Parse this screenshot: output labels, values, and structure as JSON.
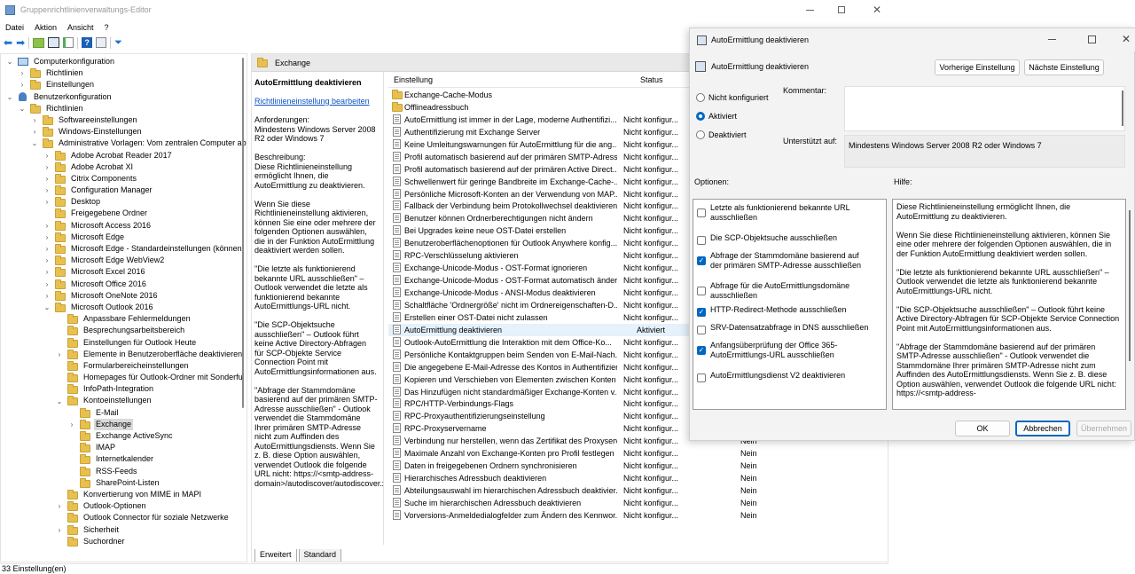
{
  "window": {
    "title": "Gruppenrichtlinienverwaltungs-Editor"
  },
  "menu": [
    "Datei",
    "Aktion",
    "Ansicht",
    "?"
  ],
  "tree": [
    {
      "label": "Computerkonfiguration",
      "lvl": 0,
      "exp": "v",
      "ic": "pc"
    },
    {
      "label": "Richtlinien",
      "lvl": 1,
      "exp": ">",
      "ic": "f"
    },
    {
      "label": "Einstellungen",
      "lvl": 1,
      "exp": ">",
      "ic": "f"
    },
    {
      "label": "Benutzerkonfiguration",
      "lvl": 0,
      "exp": "v",
      "ic": "user"
    },
    {
      "label": "Richtlinien",
      "lvl": 1,
      "exp": "v",
      "ic": "f"
    },
    {
      "label": "Softwareeinstellungen",
      "lvl": 2,
      "exp": ">",
      "ic": "f"
    },
    {
      "label": "Windows-Einstellungen",
      "lvl": 2,
      "exp": ">",
      "ic": "f"
    },
    {
      "label": "Administrative Vorlagen: Vom zentralen Computer ab",
      "lvl": 2,
      "exp": "v",
      "ic": "f"
    },
    {
      "label": "Adobe Acrobat Reader 2017",
      "lvl": 3,
      "exp": ">",
      "ic": "f"
    },
    {
      "label": "Adobe Acrobat XI",
      "lvl": 3,
      "exp": ">",
      "ic": "f"
    },
    {
      "label": "Citrix Components",
      "lvl": 3,
      "exp": ">",
      "ic": "f"
    },
    {
      "label": "Configuration Manager",
      "lvl": 3,
      "exp": ">",
      "ic": "f"
    },
    {
      "label": "Desktop",
      "lvl": 3,
      "exp": ">",
      "ic": "f"
    },
    {
      "label": "Freigegebene Ordner",
      "lvl": 3,
      "exp": "",
      "ic": "f"
    },
    {
      "label": "Microsoft Access 2016",
      "lvl": 3,
      "exp": ">",
      "ic": "f"
    },
    {
      "label": "Microsoft Edge",
      "lvl": 3,
      "exp": ">",
      "ic": "f"
    },
    {
      "label": "Microsoft Edge - Standardeinstellungen (können",
      "lvl": 3,
      "exp": ">",
      "ic": "f"
    },
    {
      "label": "Microsoft Edge WebView2",
      "lvl": 3,
      "exp": ">",
      "ic": "f"
    },
    {
      "label": "Microsoft Excel 2016",
      "lvl": 3,
      "exp": ">",
      "ic": "f"
    },
    {
      "label": "Microsoft Office 2016",
      "lvl": 3,
      "exp": ">",
      "ic": "f"
    },
    {
      "label": "Microsoft OneNote 2016",
      "lvl": 3,
      "exp": ">",
      "ic": "f"
    },
    {
      "label": "Microsoft Outlook 2016",
      "lvl": 3,
      "exp": "v",
      "ic": "f"
    },
    {
      "label": "Anpassbare Fehlermeldungen",
      "lvl": 4,
      "exp": "",
      "ic": "f"
    },
    {
      "label": "Besprechungsarbeitsbereich",
      "lvl": 4,
      "exp": "",
      "ic": "f"
    },
    {
      "label": "Einstellungen für Outlook Heute",
      "lvl": 4,
      "exp": "",
      "ic": "f"
    },
    {
      "label": "Elemente in Benutzeroberfläche deaktivieren",
      "lvl": 4,
      "exp": ">",
      "ic": "f"
    },
    {
      "label": "Formularbereicheinstellungen",
      "lvl": 4,
      "exp": "",
      "ic": "f"
    },
    {
      "label": "Homepages für Outlook-Ordner mit Sonderfu",
      "lvl": 4,
      "exp": "",
      "ic": "f"
    },
    {
      "label": "InfoPath-Integration",
      "lvl": 4,
      "exp": "",
      "ic": "f"
    },
    {
      "label": "Kontoeinstellungen",
      "lvl": 4,
      "exp": "v",
      "ic": "f"
    },
    {
      "label": "E-Mail",
      "lvl": 5,
      "exp": "",
      "ic": "f"
    },
    {
      "label": "Exchange",
      "lvl": 5,
      "exp": ">",
      "ic": "f",
      "sel": true
    },
    {
      "label": "Exchange ActiveSync",
      "lvl": 5,
      "exp": "",
      "ic": "f"
    },
    {
      "label": "IMAP",
      "lvl": 5,
      "exp": "",
      "ic": "f"
    },
    {
      "label": "Internetkalender",
      "lvl": 5,
      "exp": "",
      "ic": "f"
    },
    {
      "label": "RSS-Feeds",
      "lvl": 5,
      "exp": "",
      "ic": "f"
    },
    {
      "label": "SharePoint-Listen",
      "lvl": 5,
      "exp": "",
      "ic": "f"
    },
    {
      "label": "Konvertierung von MIME in MAPI",
      "lvl": 4,
      "exp": "",
      "ic": "f"
    },
    {
      "label": "Outlook-Optionen",
      "lvl": 4,
      "exp": ">",
      "ic": "f"
    },
    {
      "label": "Outlook Connector für soziale Netzwerke",
      "lvl": 4,
      "exp": "",
      "ic": "f"
    },
    {
      "label": "Sicherheit",
      "lvl": 4,
      "exp": ">",
      "ic": "f"
    },
    {
      "label": "Suchordner",
      "lvl": 4,
      "exp": "",
      "ic": "f"
    }
  ],
  "folder_header": "Exchange",
  "desc": {
    "title": "AutoErmittlung deaktivieren",
    "link": "Richtlinieneinstellung bearbeiten",
    "text": "Anforderungen:\nMindestens Windows Server 2008 R2 oder Windows 7\n\nBeschreibung:\nDiese Richtlinieneinstellung ermöglicht Ihnen, die AutoErmittlung zu deaktivieren.\n\nWenn Sie diese Richtlinieneinstellung aktivieren, können Sie eine oder mehrere der folgenden Optionen auswählen, die in der Funktion AutoErmittlung deaktiviert werden sollen.\n\n\"Die letzte als funktionierend bekannte URL ausschließen\" – Outlook verwendet die letzte als funktionierend bekannte AutoErmittlungs-URL nicht.\n\n\"Die SCP-Objektsuche ausschließen\" – Outlook führt keine Active Directory-Abfragen für SCP-Objekte Service Connection Point mit AutoErmittlungsinformationen aus.\n\n\"Abfrage der Stammdomäne basierend auf der primären SMTP-Adresse ausschließen\" - Outlook verwendet die Stammdomäne Ihrer primären SMTP-Adresse nicht zum Auffinden des AutoErmittlungsdiensts. Wenn Sie z. B. diese Option auswählen, verwendet Outlook die folgende URL nicht: https://<smtp-address-domain>/autodiscover/autodiscover.xml."
  },
  "list_headers": {
    "setting": "Einstellung",
    "status": "Status"
  },
  "list_rows": [
    {
      "name": "Exchange-Cache-Modus",
      "status": "",
      "c3": "",
      "folder": true
    },
    {
      "name": "Offlineadressbuch",
      "status": "",
      "c3": "",
      "folder": true
    },
    {
      "name": "AutoErmittlung ist immer in der Lage, moderne Authentifizi...",
      "status": "Nicht konfigur...",
      "c3": ""
    },
    {
      "name": "Authentifizierung mit Exchange Server",
      "status": "Nicht konfigur...",
      "c3": ""
    },
    {
      "name": "Keine Umleitungswarnungen für AutoErmittlung für die ang...",
      "status": "Nicht konfigur...",
      "c3": ""
    },
    {
      "name": "Profil automatisch basierend auf der primären SMTP-Adress...",
      "status": "Nicht konfigur...",
      "c3": ""
    },
    {
      "name": "Profil automatisch basierend auf der primären Active Direct...",
      "status": "Nicht konfigur...",
      "c3": ""
    },
    {
      "name": "Schwellenwert für geringe Bandbreite im Exchange-Cache-...",
      "status": "Nicht konfigur...",
      "c3": ""
    },
    {
      "name": "Persönliche Microsoft-Konten an der Verwendung von MAP...",
      "status": "Nicht konfigur...",
      "c3": ""
    },
    {
      "name": "Fallback der Verbindung beim Protokollwechsel deaktivieren",
      "status": "Nicht konfigur...",
      "c3": ""
    },
    {
      "name": "Benutzer können Ordnerberechtigungen nicht ändern",
      "status": "Nicht konfigur...",
      "c3": ""
    },
    {
      "name": "Bei Upgrades keine neue OST-Datei erstellen",
      "status": "Nicht konfigur...",
      "c3": ""
    },
    {
      "name": "Benutzeroberflächenoptionen für Outlook Anywhere konfig...",
      "status": "Nicht konfigur...",
      "c3": ""
    },
    {
      "name": "RPC-Verschlüsselung aktivieren",
      "status": "Nicht konfigur...",
      "c3": ""
    },
    {
      "name": "Exchange-Unicode-Modus - OST-Format ignorieren",
      "status": "Nicht konfigur...",
      "c3": ""
    },
    {
      "name": "Exchange-Unicode-Modus - OST-Format automatisch ändern",
      "status": "Nicht konfigur...",
      "c3": ""
    },
    {
      "name": "Exchange-Unicode-Modus - ANSI-Modus deaktivieren",
      "status": "Nicht konfigur...",
      "c3": ""
    },
    {
      "name": "Schaltfläche 'Ordnergröße' nicht im Ordnereigenschaften-D...",
      "status": "Nicht konfigur...",
      "c3": ""
    },
    {
      "name": "Erstellen einer OST-Datei nicht zulassen",
      "status": "Nicht konfigur...",
      "c3": ""
    },
    {
      "name": "AutoErmittlung deaktivieren",
      "status": "Aktiviert",
      "c3": "",
      "sel": true
    },
    {
      "name": "Outlook-AutoErmittlung die Interaktion mit dem Office-Ko...",
      "status": "Nicht konfigur...",
      "c3": ""
    },
    {
      "name": "Persönliche Kontaktgruppen beim Senden von E-Mail-Nach...",
      "status": "Nicht konfigur...",
      "c3": ""
    },
    {
      "name": "Die angegebene E-Mail-Adresse des Kontos in Authentifizier...",
      "status": "Nicht konfigur...",
      "c3": ""
    },
    {
      "name": "Kopieren und Verschieben von Elementen zwischen Konten ...",
      "status": "Nicht konfigur...",
      "c3": ""
    },
    {
      "name": "Das Hinzufügen nicht standardmäßiger Exchange-Konten v...",
      "status": "Nicht konfigur...",
      "c3": ""
    },
    {
      "name": "RPC/HTTP-Verbindungs-Flags",
      "status": "Nicht konfigur...",
      "c3": ""
    },
    {
      "name": "RPC-Proxyauthentifizierungseinstellung",
      "status": "Nicht konfigur...",
      "c3": ""
    },
    {
      "name": "RPC-Proxyservername",
      "status": "Nicht konfigur...",
      "c3": ""
    },
    {
      "name": "Verbindung nur herstellen, wenn das Zertifikat des Proxyserv...",
      "status": "Nicht konfigur...",
      "c3": "Nein"
    },
    {
      "name": "Maximale Anzahl von Exchange-Konten pro Profil festlegen",
      "status": "Nicht konfigur...",
      "c3": "Nein"
    },
    {
      "name": "Daten in freigegebenen Ordnern synchronisieren",
      "status": "Nicht konfigur...",
      "c3": "Nein"
    },
    {
      "name": "Hierarchisches Adressbuch deaktivieren",
      "status": "Nicht konfigur...",
      "c3": "Nein"
    },
    {
      "name": "Abteilungsauswahl im hierarchischen Adressbuch deaktivier...",
      "status": "Nicht konfigur...",
      "c3": "Nein"
    },
    {
      "name": "Suche im hierarchischen Adressbuch deaktivieren",
      "status": "Nicht konfigur...",
      "c3": "Nein"
    },
    {
      "name": "Vorversions-Anmeldedialogfelder zum Ändern des Kennwor...",
      "status": "Nicht konfigur...",
      "c3": "Nein"
    }
  ],
  "tabs": [
    "Erweitert",
    "Standard"
  ],
  "statusbar": "33 Einstellung(en)",
  "dialog": {
    "title": "AutoErmittlung deaktivieren",
    "subtitle": "AutoErmittlung deaktivieren",
    "prev_btn": "Vorherige Einstellung",
    "next_btn": "Nächste Einstellung",
    "radio": [
      {
        "label": "Nicht konfiguriert",
        "on": false
      },
      {
        "label": "Aktiviert",
        "on": true
      },
      {
        "label": "Deaktiviert",
        "on": false
      }
    ],
    "comment_label": "Kommentar:",
    "supported_label": "Unterstützt auf:",
    "supported_value": "Mindestens Windows Server 2008 R2 oder Windows 7",
    "options_label": "Optionen:",
    "help_label": "Hilfe:",
    "options": [
      {
        "label": "Letzte als funktionierend bekannte URL ausschließen",
        "on": false
      },
      {
        "label": "Die SCP-Objektsuche ausschließen",
        "on": false
      },
      {
        "label": "Abfrage der Stammdomäne basierend auf der primären SMTP-Adresse ausschließen",
        "on": true
      },
      {
        "label": "Abfrage für die AutoErmittlungsdomäne ausschließen",
        "on": false
      },
      {
        "label": "HTTP-Redirect-Methode ausschließen",
        "on": true
      },
      {
        "label": "SRV-Datensatzabfrage in DNS ausschließen",
        "on": false
      },
      {
        "label": "Anfangsüberprüfung der Office 365-AutoErmittlungs-URL ausschließen",
        "on": true
      },
      {
        "label": "AutoErmittlungsdienst V2 deaktivieren",
        "on": false
      }
    ],
    "help_text": "Diese Richtlinieneinstellung ermöglicht Ihnen, die AutoErmittlung zu deaktivieren.\n\nWenn Sie diese Richtlinieneinstellung aktivieren, können Sie eine oder mehrere der folgenden Optionen auswählen, die in der Funktion AutoErmittlung deaktiviert werden sollen.\n\n\"Die letzte als funktionierend bekannte URL ausschließen\" – Outlook verwendet die letzte als funktionierend bekannte AutoErmittlungs-URL nicht.\n\n\"Die SCP-Objektsuche ausschließen\" – Outlook führt keine Active Directory-Abfragen für SCP-Objekte Service Connection Point mit AutoErmittlungsinformationen aus.\n\n\"Abfrage der Stammdomäne basierend auf der primären SMTP-Adresse ausschließen\" - Outlook verwendet die Stammdomäne Ihrer primären SMTP-Adresse nicht zum Auffinden des AutoErmittlungsdiensts. Wenn Sie z. B. diese Option auswählen, verwendet Outlook die folgende URL nicht: https://<smtp-address-",
    "ok": "OK",
    "cancel": "Abbrechen",
    "apply": "Übernehmen"
  }
}
